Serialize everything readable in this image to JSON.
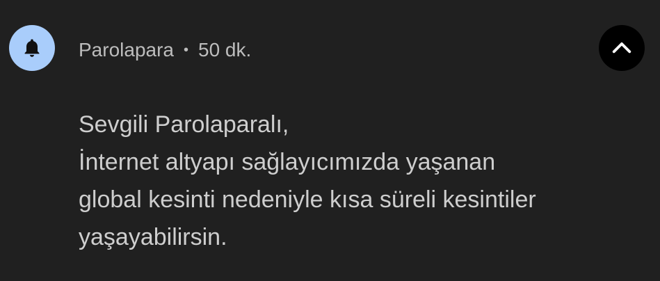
{
  "notification": {
    "app_name": "Parolapara",
    "separator": "•",
    "time": "50 dk.",
    "icon": "bell-icon",
    "collapse_icon": "chevron-up-icon",
    "accent_color": "#a9cdfb",
    "message_lines": [
      "Sevgili Parolaparalı,",
      "İnternet altyapı sağlayıcımızda yaşanan",
      "global kesinti nedeniyle kısa süreli kesintiler",
      "yaşayabilirsin."
    ]
  }
}
